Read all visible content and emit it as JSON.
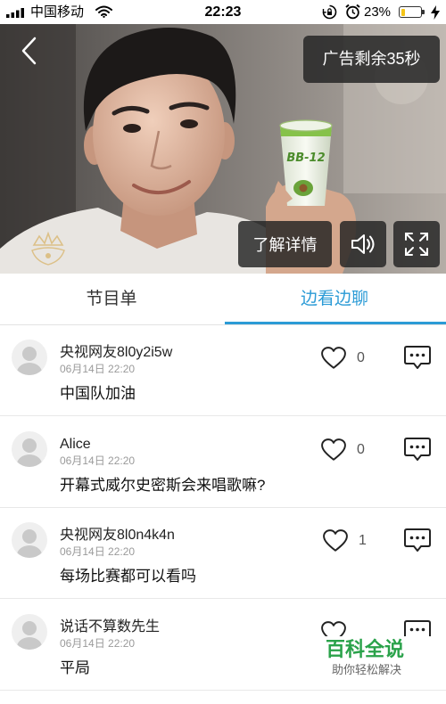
{
  "status_bar": {
    "carrier": "中国移动",
    "time": "22:23",
    "battery_text": "23%",
    "battery_fill": 0.23,
    "icons": [
      "signal-icon",
      "wifi-icon",
      "rotation-lock-icon",
      "alarm-icon",
      "battery-icon",
      "charging-icon"
    ]
  },
  "player": {
    "ad_countdown": "广告剩余35秒",
    "learn_more": "了解详情",
    "product_label": "BB-12",
    "icons": [
      "back-icon",
      "volume-icon",
      "fullscreen-icon",
      "brand-logo-icon"
    ]
  },
  "tabs": [
    {
      "label": "节目单",
      "active": false
    },
    {
      "label": "边看边聊",
      "active": true
    }
  ],
  "comments": [
    {
      "name": "央视网友8l0y2i5w",
      "time": "06月14日 22:20",
      "text": "中国队加油",
      "likes": "0"
    },
    {
      "name": "Alice",
      "time": "06月14日 22:20",
      "text": "开幕式威尔史密斯会来唱歌嘛?",
      "likes": "0"
    },
    {
      "name": "央视网友8l0n4k4n",
      "time": "06月14日 22:20",
      "text": "每场比赛都可以看吗",
      "likes": "1"
    },
    {
      "name": "说话不算数先生",
      "time": "06月14日 22:20",
      "text": "平局"
    }
  ],
  "comment_icons": [
    "avatar-placeholder-icon",
    "heart-icon",
    "comment-icon"
  ],
  "watermark": {
    "title": "百科全说",
    "subtitle": "助你轻松解决"
  },
  "colors": {
    "accent": "#2b9bd6",
    "battery": "#f5c518",
    "watermark": "#2aa24a",
    "overlay": "#2b2b2b"
  }
}
